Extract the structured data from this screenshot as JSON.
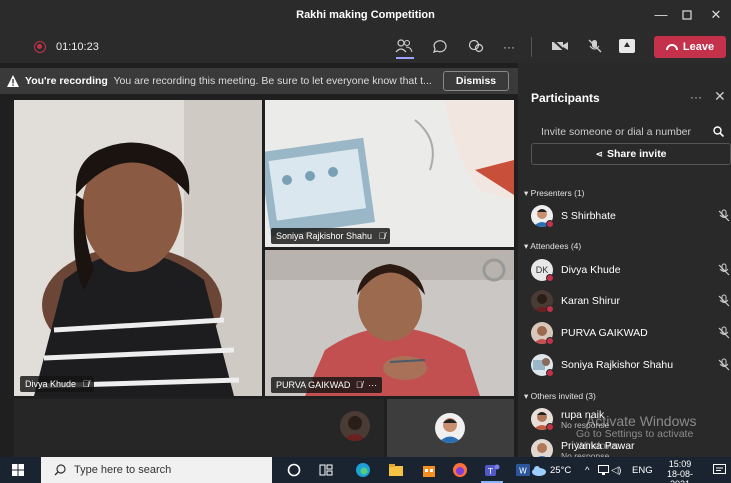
{
  "window": {
    "title": "Rakhi making Competition"
  },
  "toolbar": {
    "timer": "01:10:23",
    "leave_label": "Leave",
    "colors": {
      "leave": "#c4314b",
      "recording": "#c4314b"
    }
  },
  "banner": {
    "bold": "You're recording",
    "message": "You are recording this meeting. Be sure to let everyone know that t...",
    "dismiss_label": "Dismiss"
  },
  "tiles": {
    "divya": "Divya Khude",
    "soniya": "Soniya Rajkishor Shahu",
    "purva": "PURVA GAIKWAD",
    "purva_more": "···"
  },
  "panel": {
    "title": "Participants",
    "more": "···",
    "close": "✕",
    "invite_placeholder": "Invite someone or dial a number",
    "share_invite_label": "Share invite",
    "presenters_label": "Presenters (1)",
    "attendees_label": "Attendees (4)",
    "others_label": "Others invited (3)",
    "presenters": [
      {
        "name": "S Shirbhate"
      }
    ],
    "attendees": [
      {
        "name": "Divya Khude",
        "initials": "DK"
      },
      {
        "name": "Karan Shirur"
      },
      {
        "name": "PURVA GAIKWAD"
      },
      {
        "name": "Soniya Rajkishor Shahu"
      }
    ],
    "others": [
      {
        "name": "rupa naik",
        "status": "No response"
      },
      {
        "name": "Priyanka Pawar",
        "status": "No response"
      }
    ]
  },
  "watermark": {
    "line1": "Activate Windows",
    "line2": "Go to Settings to activate Windows."
  },
  "taskbar": {
    "search_placeholder": "Type here to search",
    "temperature": "25°C",
    "language": "ENG",
    "time": "15:09",
    "date": "18-08-2021"
  }
}
